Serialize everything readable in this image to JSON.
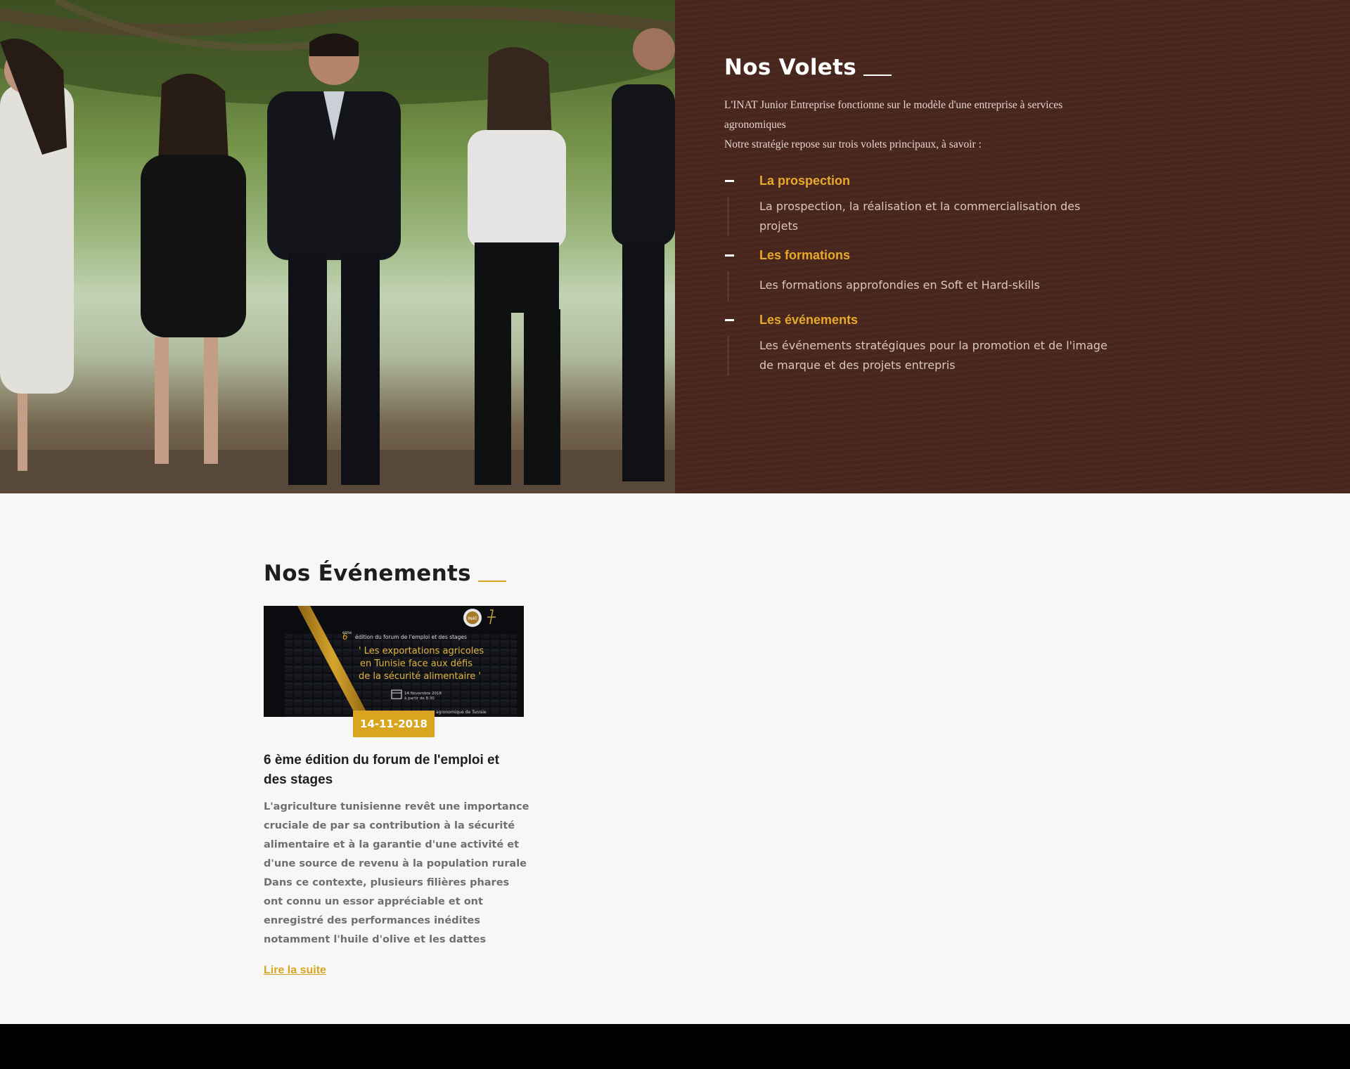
{
  "volets": {
    "title": "Nos Volets",
    "intro_line1": "L'INAT Junior Entreprise fonctionne sur le modèle d'une entreprise à services agronomiques",
    "intro_line2": "Notre stratégie repose sur trois volets principaux, à savoir :",
    "items": [
      {
        "title": "La prospection",
        "text": "La prospection, la réalisation et la commercialisation des projets"
      },
      {
        "title": "Les formations",
        "text": "Les formations approfondies en Soft et Hard-skills"
      },
      {
        "title": "Les événements",
        "text": "Les événements stratégiques pour la promotion et de l'image de marque et des projets entrepris"
      }
    ]
  },
  "events": {
    "title": "Nos Événements",
    "card": {
      "poster": {
        "edition_number": "6",
        "edition_sup": "eme",
        "edition_line": "édition du forum de l'emploi et des stages",
        "quote_line1": "' Les exportations agricoles",
        "quote_line2": "en Tunisie face aux défis",
        "quote_line3": "de la sécurité alimentaire '",
        "date_line1": "14 Novembre 2018",
        "date_line2": "à partir de 8:30",
        "place": "agronomique de Tunisie",
        "logo_text": "INAT"
      },
      "date": "14-11-2018",
      "title": "6 ème édition du forum de l'emploi et des stages",
      "description": "L'agriculture tunisienne revêt une importance cruciale de par sa contribution à la sécurité alimentaire et à la garantie d'une activité et d'une source de revenu à la population rurale Dans ce contexte, plusieurs filières phares ont connu un essor appréciable et ont enregistré des performances inédites notamment l'huile d'olive et les dattes",
      "link_label": "Lire la suite"
    }
  },
  "colors": {
    "brown_panel": "#4a271e",
    "gold_accent": "#d9a520",
    "accordion_title": "#e8a92a",
    "footer": "#000000"
  },
  "icons": {
    "accordion_marker": "minus-icon",
    "poster_calendar": "calendar-icon"
  }
}
